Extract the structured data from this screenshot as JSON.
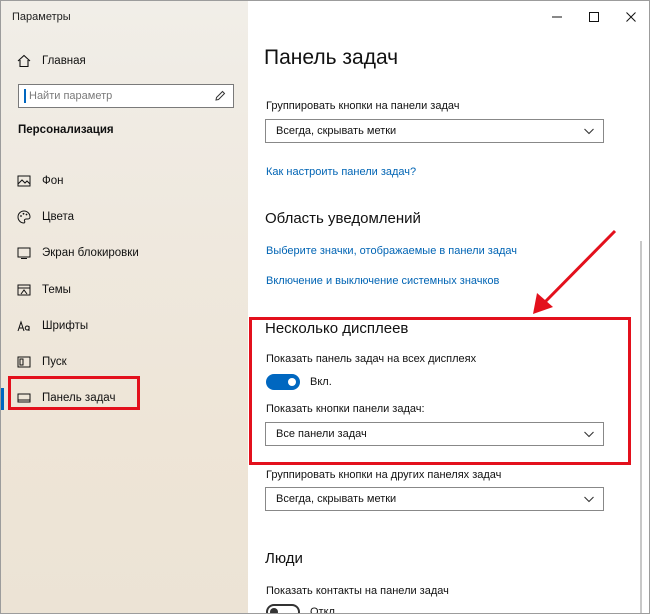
{
  "window": {
    "title": "Параметры"
  },
  "sidebar": {
    "home_label": "Главная",
    "search_placeholder": "Найти параметр",
    "section_title": "Персонализация",
    "items": [
      {
        "label": "Фон",
        "icon": "image-icon"
      },
      {
        "label": "Цвета",
        "icon": "palette-icon"
      },
      {
        "label": "Экран блокировки",
        "icon": "lock-screen-icon"
      },
      {
        "label": "Темы",
        "icon": "themes-icon"
      },
      {
        "label": "Шрифты",
        "icon": "fonts-icon"
      },
      {
        "label": "Пуск",
        "icon": "start-icon"
      },
      {
        "label": "Панель задач",
        "icon": "taskbar-icon",
        "active": true
      }
    ]
  },
  "main": {
    "title": "Панель задач",
    "group_buttons_label": "Группировать кнопки на панели задач",
    "group_buttons_value": "Всегда, скрывать метки",
    "help_link": "Как настроить панели задач?",
    "notifications_heading": "Область уведомлений",
    "notif_link_1": "Выберите значки, отображаемые в панели задач",
    "notif_link_2": "Включение и выключение системных значков",
    "multi_display_heading": "Несколько дисплеев",
    "show_all_displays_label": "Показать панель задач на всех дисплеях",
    "show_all_displays_state": "Вкл.",
    "show_buttons_label": "Показать кнопки панели задач:",
    "show_buttons_value": "Все панели задач",
    "group_other_label": "Группировать кнопки на других панелях задач",
    "group_other_value": "Всегда, скрывать метки",
    "people_heading": "Люди",
    "show_contacts_label": "Показать контакты на панели задач",
    "show_contacts_state": "Откл."
  },
  "colors": {
    "accent": "#0067c0",
    "link": "#0064b4",
    "annotation_red": "#e3101c"
  }
}
